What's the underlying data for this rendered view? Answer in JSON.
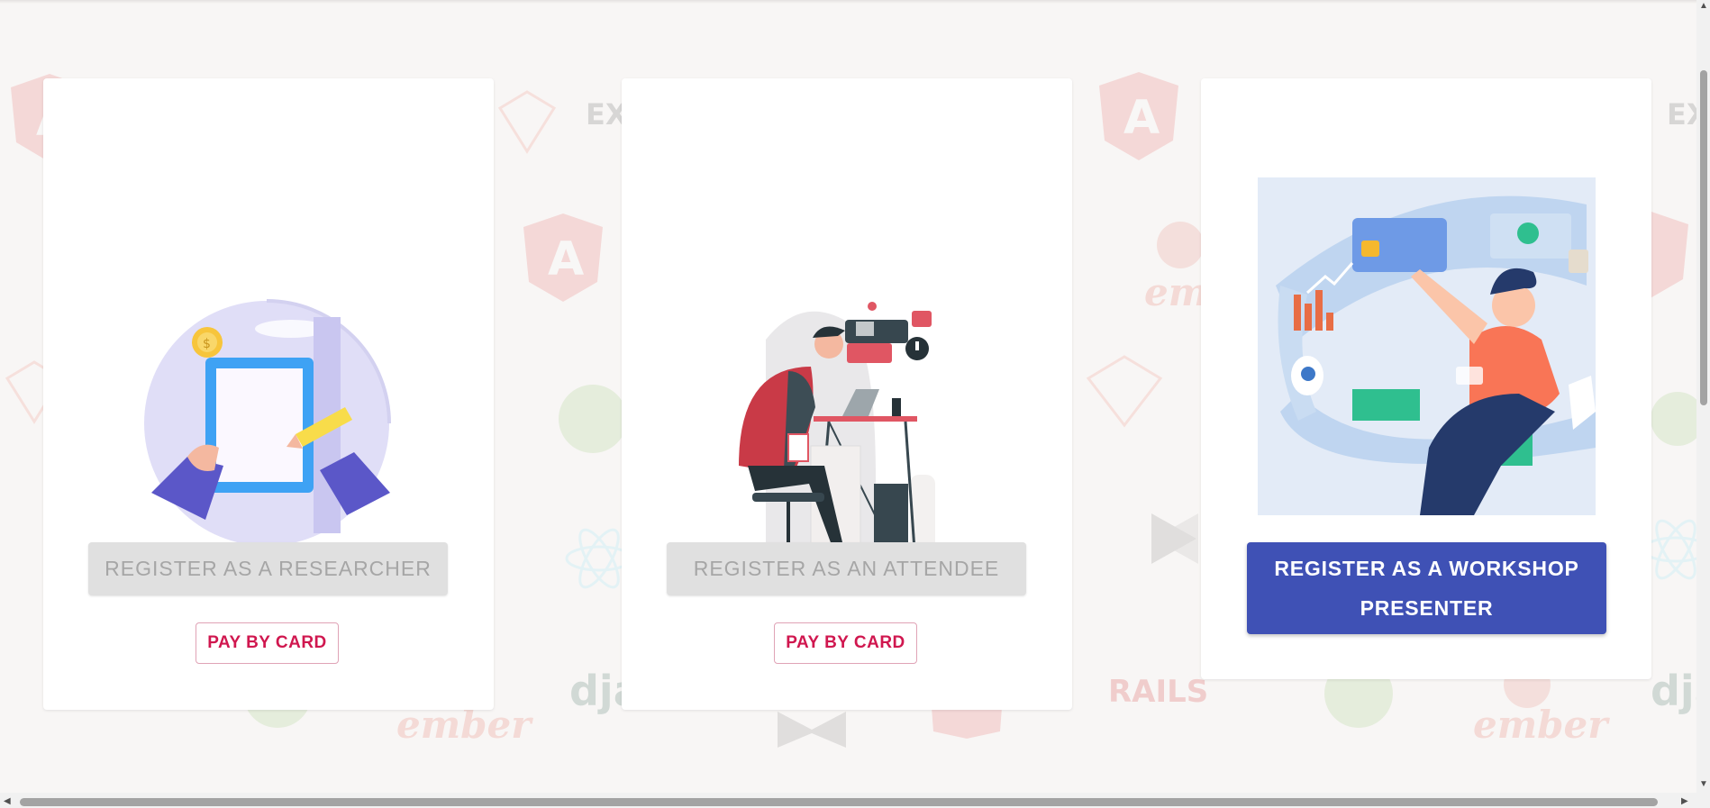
{
  "cards": [
    {
      "name": "researcher",
      "illustration": "woman-signing-document-illustration",
      "register_label": "REGISTER AS A RESEARCHER",
      "register_state": "disabled",
      "pay_label": "PAY BY CARD"
    },
    {
      "name": "attendee",
      "illustration": "man-at-desk-with-laptop-illustration",
      "register_label": "REGISTER AS AN ATTENDEE",
      "register_state": "disabled",
      "pay_label": "PAY BY CARD"
    },
    {
      "name": "workshop-presenter",
      "illustration": "man-with-digital-payment-ring-illustration",
      "register_label": "REGISTER AS A WORKSHOP PRESENTER",
      "register_state": "enabled"
    }
  ],
  "background_logos": [
    "angular-logo",
    "laravel-logo",
    "ember-logo",
    "rails-logo",
    "django-logo",
    "react-logo",
    "spring-logo",
    "express-logo",
    "codeigniter-logo"
  ],
  "background_words": {
    "ex": "EX",
    "ember": "ember",
    "rails": "RAILS",
    "dja": "dja"
  },
  "colors": {
    "primary": "#3f51b5",
    "accent": "#d0174f",
    "disabled_bg": "#e0e0e0",
    "disabled_text": "#a6a6a6",
    "page_bg": "#f8f6f5"
  }
}
